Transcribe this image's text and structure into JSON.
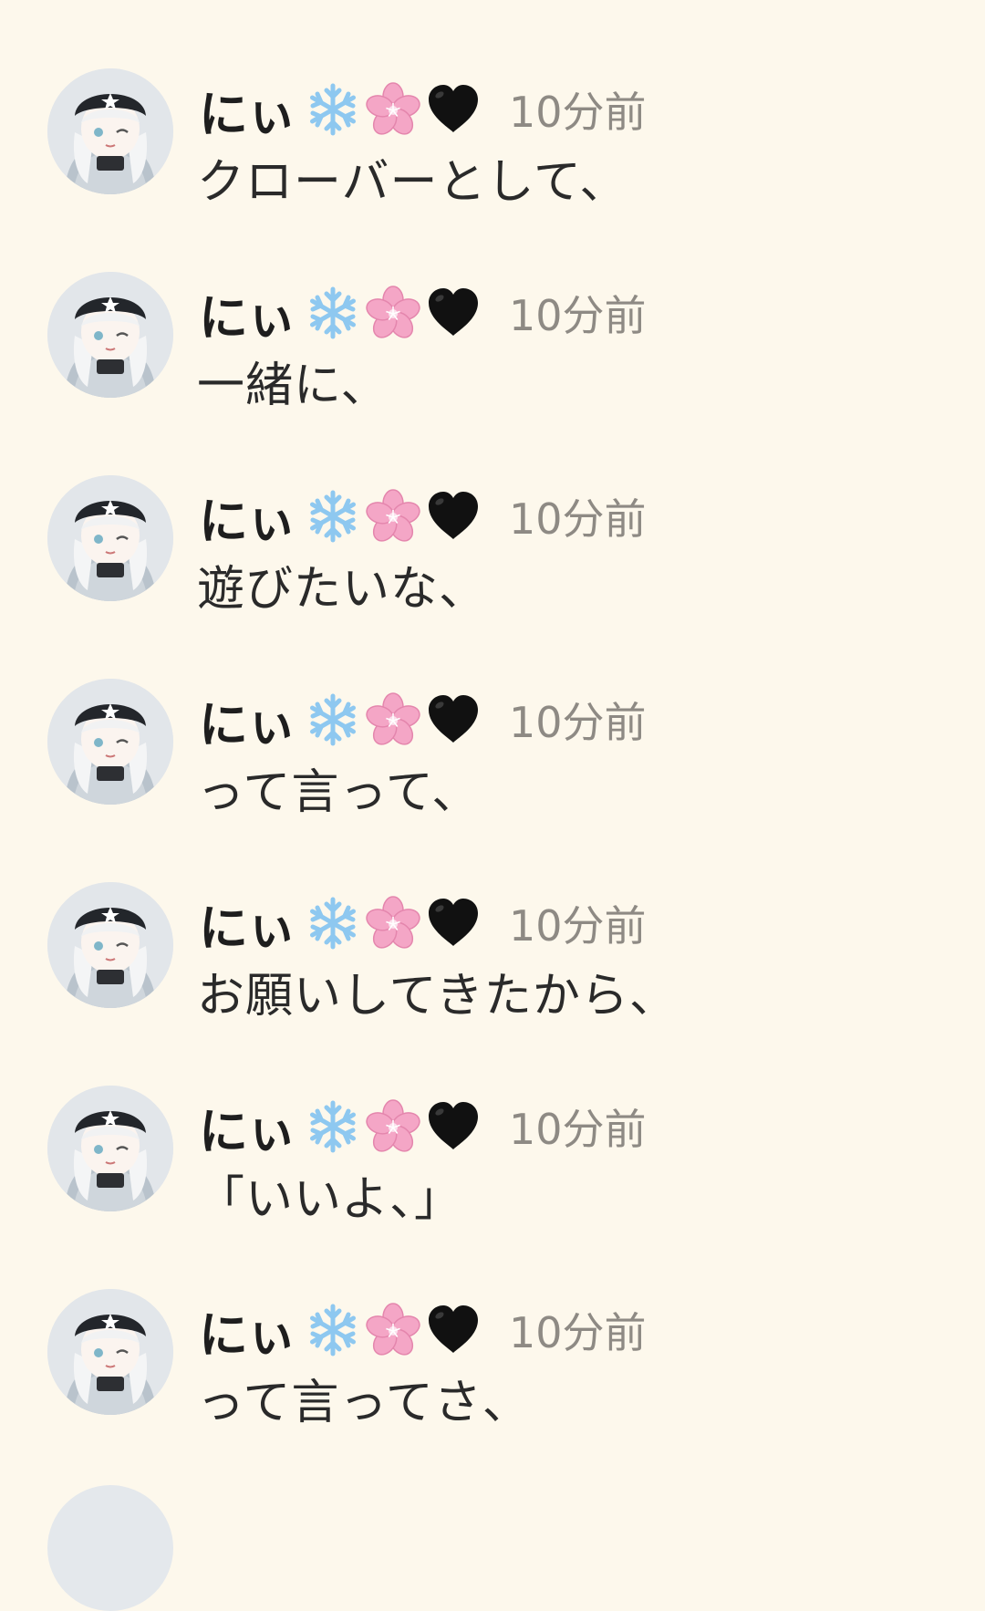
{
  "feed": {
    "messages": [
      {
        "name": "にぃ",
        "time": "10分前",
        "text": "クローバーとして、"
      },
      {
        "name": "にぃ",
        "time": "10分前",
        "text": "一緒に、"
      },
      {
        "name": "にぃ",
        "time": "10分前",
        "text": "遊びたいな、"
      },
      {
        "name": "にぃ",
        "time": "10分前",
        "text": "って言って、"
      },
      {
        "name": "にぃ",
        "time": "10分前",
        "text": "お願いしてきたから、"
      },
      {
        "name": "にぃ",
        "time": "10分前",
        "text": "「いいよ、」"
      },
      {
        "name": "にぃ",
        "time": "10分前",
        "text": "って言ってさ、"
      }
    ]
  },
  "icons": {
    "avatar": "avatar-anime-girl-star-beanie",
    "name_emoji": [
      "snowflake-icon",
      "cherry-blossom-icon",
      "black-heart-icon"
    ]
  },
  "colors": {
    "background": "#fdf8ec",
    "name": "#1e1e1e",
    "time": "#8e8a84",
    "text": "#2a2a2a",
    "snowflake": "#8ec8f0",
    "blossom": "#f4a6c6",
    "heart": "#111111"
  }
}
